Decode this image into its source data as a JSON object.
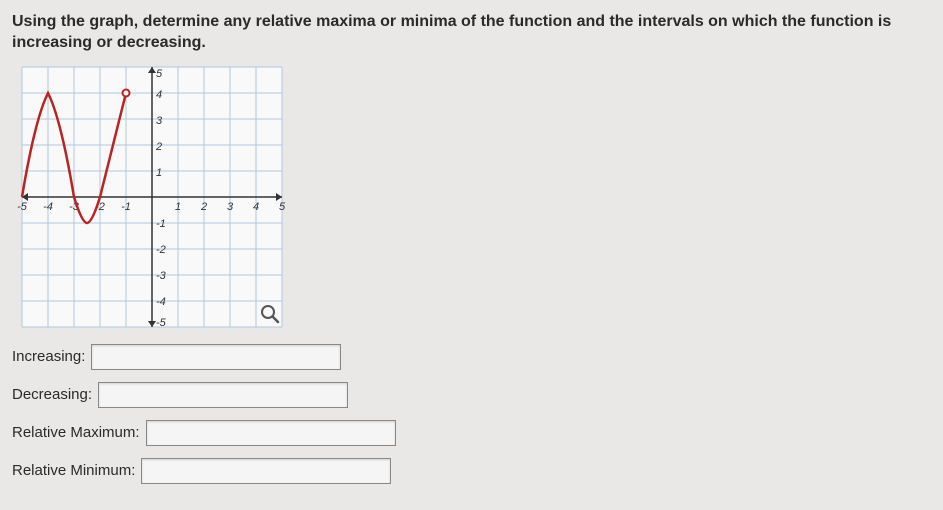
{
  "question": "Using the graph, determine any relative maxima or minima of the function and the intervals on which the function is increasing or decreasing.",
  "labels": {
    "increasing": "Increasing:",
    "decreasing": "Decreasing:",
    "rel_max": "Relative Maximum:",
    "rel_min": "Relative Minimum:"
  },
  "inputs": {
    "increasing": "",
    "decreasing": "",
    "rel_max": "",
    "rel_min": ""
  },
  "chart_data": {
    "type": "line",
    "title": "",
    "xlabel": "",
    "ylabel": "",
    "xlim": [
      -5,
      5
    ],
    "ylim": [
      -5,
      5
    ],
    "x_ticks": [
      -5,
      -4,
      -3,
      -2,
      -1,
      1,
      2,
      3,
      4,
      5
    ],
    "y_ticks": [
      -5,
      -4,
      -3,
      -2,
      -1,
      1,
      2,
      3,
      4,
      5
    ],
    "curve_points": [
      {
        "x": -5,
        "y": 0
      },
      {
        "x": -4.5,
        "y": 3
      },
      {
        "x": -4,
        "y": 4
      },
      {
        "x": -3.5,
        "y": 3
      },
      {
        "x": -3,
        "y": 0
      },
      {
        "x": -2.5,
        "y": -1
      },
      {
        "x": -2,
        "y": 0
      },
      {
        "x": -1.5,
        "y": 2
      },
      {
        "x": -1,
        "y": 4
      }
    ],
    "features": {
      "relative_maximum": {
        "x": -4,
        "y": 4
      },
      "relative_minimum": {
        "x": -2.5,
        "y": -1
      },
      "endpoint_open": {
        "x": -1,
        "y": 4
      }
    }
  }
}
